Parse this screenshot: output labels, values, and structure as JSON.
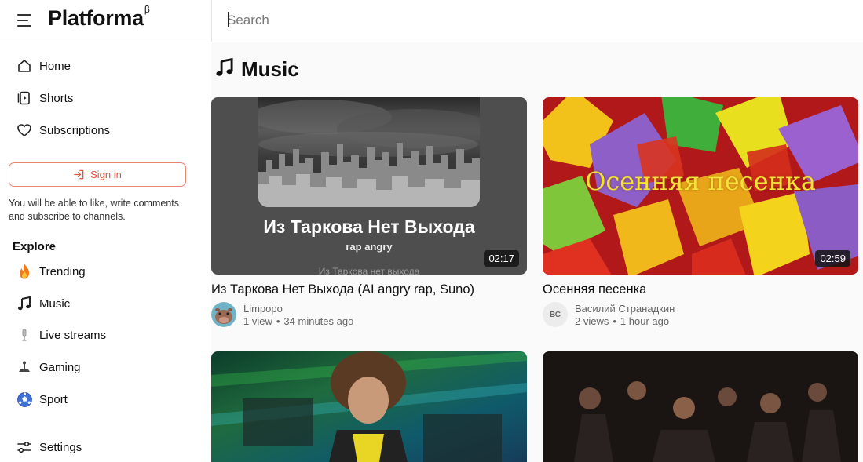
{
  "header": {
    "logo_text": "Platforma",
    "logo_superscript": "β",
    "search_placeholder": "Search"
  },
  "sidebar": {
    "nav": [
      {
        "label": "Home",
        "icon": "home-icon"
      },
      {
        "label": "Shorts",
        "icon": "shorts-icon"
      },
      {
        "label": "Subscriptions",
        "icon": "heart-icon"
      }
    ],
    "sign_in_label": "Sign in",
    "sign_in_note": "You will be able to like, write comments and subscribe to channels.",
    "explore_heading": "Explore",
    "explore": [
      {
        "label": "Trending",
        "icon": "fire-icon"
      },
      {
        "label": "Music",
        "icon": "music-note-icon"
      },
      {
        "label": "Live streams",
        "icon": "microphone-icon"
      },
      {
        "label": "Gaming",
        "icon": "joystick-icon"
      },
      {
        "label": "Sport",
        "icon": "soccer-ball-icon"
      }
    ],
    "settings_label": "Settings"
  },
  "main": {
    "page_title": "Music",
    "videos": [
      {
        "title": "Из Таркова Нет Выхода (AI angry rap, Suno)",
        "duration": "02:17",
        "channel": "Limpopo",
        "views": "1 view",
        "age": "34 minutes ago",
        "thumb_title": "Из Таркова Нет Выхода",
        "thumb_subtitle": "rap angry",
        "thumb_faded": "Из Таркова нет выхода"
      },
      {
        "title": "Осенняя песенка",
        "duration": "02:59",
        "channel": "Василий Странадкин",
        "channel_initials": "ВС",
        "views": "2 views",
        "age": "1 hour ago",
        "thumb_title": "Осенняя песенка"
      }
    ],
    "meta_separator": "•"
  },
  "colors": {
    "accent": "#e0553d",
    "text": "#111111",
    "muted": "#666666"
  }
}
